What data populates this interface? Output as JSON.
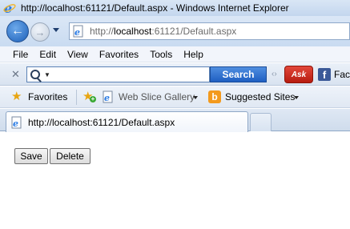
{
  "window": {
    "title": "http://localhost:61121/Default.aspx - Windows Internet Explorer"
  },
  "address": {
    "prefix": "http://",
    "host": "localhost",
    "suffix": ":61121/Default.aspx"
  },
  "menu": [
    "File",
    "Edit",
    "View",
    "Favorites",
    "Tools",
    "Help"
  ],
  "search": {
    "value": "",
    "button_label": "Search",
    "ask_label": "Ask",
    "facebook_label": "Face"
  },
  "favorites_bar": {
    "favorites_label": "Favorites",
    "web_slice_label": "Web Slice Gallery",
    "suggested_label": "Suggested Sites"
  },
  "tab": {
    "title": "http://localhost:61121/Default.aspx"
  },
  "page": {
    "save_label": "Save",
    "delete_label": "Delete"
  },
  "colors": {
    "search_button": "#2b6fd1",
    "ask_red": "#c8281b",
    "facebook_blue": "#3b5998",
    "favorites_star": "#e8a512"
  }
}
